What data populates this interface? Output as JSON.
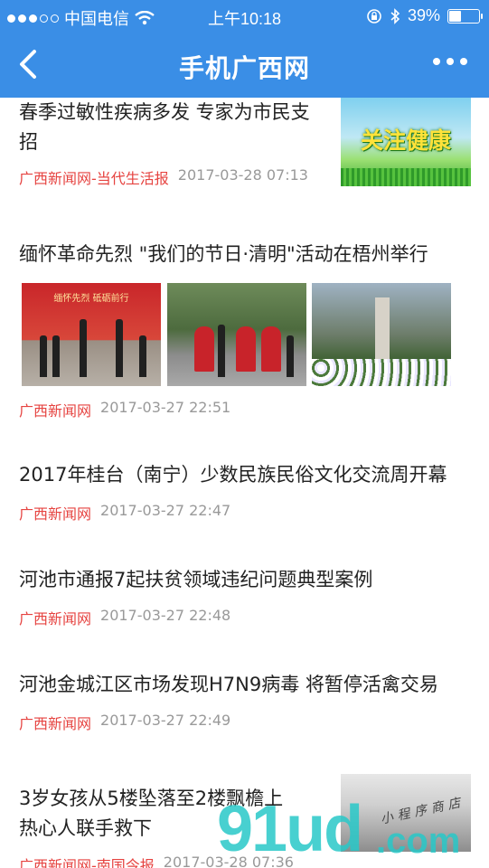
{
  "status_bar": {
    "carrier": "中国电信",
    "time": "上午10:18",
    "battery": "39%",
    "battery_level": 0.39
  },
  "nav": {
    "title": "手机广西网"
  },
  "feed": [
    {
      "title": "春季过敏性疾病多发 专家为市民支招",
      "source": "广西新闻网-当代生活报",
      "time": "2017-03-28 07:13",
      "thumb_text": "关注健康"
    },
    {
      "title": "缅怀革命先烈 \"我们的节日·清明\"活动在梧州举行",
      "source": "广西新闻网",
      "time": "2017-03-27 22:51",
      "photo1_banner": "缅怀先烈 砥砺前行"
    },
    {
      "title": "2017年桂台（南宁）少数民族民俗文化交流周开幕",
      "source": "广西新闻网",
      "time": "2017-03-27 22:47"
    },
    {
      "title": "河池市通报7起扶贫领域违纪问题典型案例",
      "source": "广西新闻网",
      "time": "2017-03-27 22:48"
    },
    {
      "title": "河池金城江区市场发现H7N9病毒 将暂停活禽交易",
      "source": "广西新闻网",
      "time": "2017-03-27 22:49"
    },
    {
      "title": "3岁女孩从5楼坠落至2楼飘檐上 热心人联手救下",
      "source": "广西新闻网-南国今报",
      "time": "2017-03-28 07:36"
    }
  ],
  "watermark": {
    "main": "91ud",
    "suffix": ".com",
    "tagline": "小程序商店"
  }
}
